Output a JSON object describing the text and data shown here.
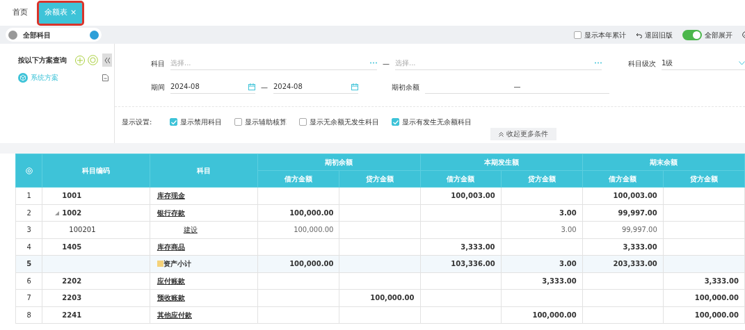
{
  "tabs": [
    {
      "label": "首页",
      "selected": false
    },
    {
      "label": "余额表",
      "selected": true,
      "close": "×"
    }
  ],
  "toolbar": {
    "scope": "全部科目",
    "year_total": {
      "label": "显示本年累计",
      "checked": false
    },
    "revert": "退回旧版",
    "expand_all": {
      "label": "全部展开",
      "on": true
    }
  },
  "scheme_panel": {
    "title": "按以下方案查询",
    "items": [
      {
        "label": "系统方案",
        "selected": true
      }
    ]
  },
  "filters": {
    "subject_label": "科目",
    "subject_from": {
      "placeholder": "选择..."
    },
    "subject_dash": "—",
    "subject_to": {
      "placeholder": "选择..."
    },
    "level_label": "科目级次",
    "level_value": "1级",
    "period_label": "期间",
    "period_from": "2024-08",
    "period_dash": "—",
    "period_to": "2024-08",
    "opening_label": "期初余额",
    "opening_value": "—",
    "display_label": "显示设置:",
    "options": [
      {
        "label": "显示禁用科目",
        "checked": true
      },
      {
        "label": "显示辅助核算",
        "checked": false
      },
      {
        "label": "显示无余额无发生科目",
        "checked": false
      },
      {
        "label": "显示有发生无余额科目",
        "checked": true
      }
    ],
    "collapse": "收起更多条件"
  },
  "table": {
    "columns": [
      "科目编码",
      "科目"
    ],
    "groups": [
      {
        "label": "期初余额",
        "sub": [
          "借方金额",
          "贷方金额"
        ]
      },
      {
        "label": "本期发生额",
        "sub": [
          "借方金额",
          "贷方金额"
        ]
      },
      {
        "label": "期末余额",
        "sub": [
          "借方金额",
          "贷方金额"
        ]
      }
    ],
    "rows": [
      {
        "no": "1",
        "kind": "account",
        "code": "1001",
        "name": "库存现金",
        "amounts": {
          "period_debit": "100,003.00",
          "closing_debit": "100,003.00"
        }
      },
      {
        "no": "2",
        "kind": "account",
        "code": "1002",
        "name": "银行存款",
        "expanded": true,
        "amounts": {
          "opening_debit": "100,000.00",
          "period_credit": "3.00",
          "closing_debit": "99,997.00"
        },
        "children": [
          {
            "no": "3",
            "kind": "account",
            "code": "100201",
            "name": "建设",
            "amounts": {
              "opening_debit": "100,000.00",
              "period_credit": "3.00",
              "closing_debit": "99,997.00"
            }
          }
        ]
      },
      {
        "no": "4",
        "kind": "account",
        "code": "1405",
        "name": "库存商品",
        "amounts": {
          "period_debit": "3,333.00",
          "closing_debit": "3,333.00"
        }
      },
      {
        "no": "5",
        "kind": "subtotal",
        "name": "资产小计",
        "amounts": {
          "opening_debit": "100,000.00",
          "period_debit": "103,336.00",
          "period_credit": "3.00",
          "closing_debit": "203,333.00"
        }
      },
      {
        "no": "6",
        "kind": "account",
        "code": "2202",
        "name": "应付账款",
        "amounts": {
          "period_credit": "3,333.00",
          "closing_credit": "3,333.00"
        }
      },
      {
        "no": "7",
        "kind": "account",
        "code": "2203",
        "name": "预收账款",
        "amounts": {
          "opening_credit": "100,000.00",
          "closing_credit": "100,000.00"
        }
      },
      {
        "no": "8",
        "kind": "account",
        "code": "2241",
        "name": "其他应付款",
        "amounts": {
          "period_credit": "100,000.00",
          "closing_credit": "100,000.00"
        }
      }
    ]
  }
}
